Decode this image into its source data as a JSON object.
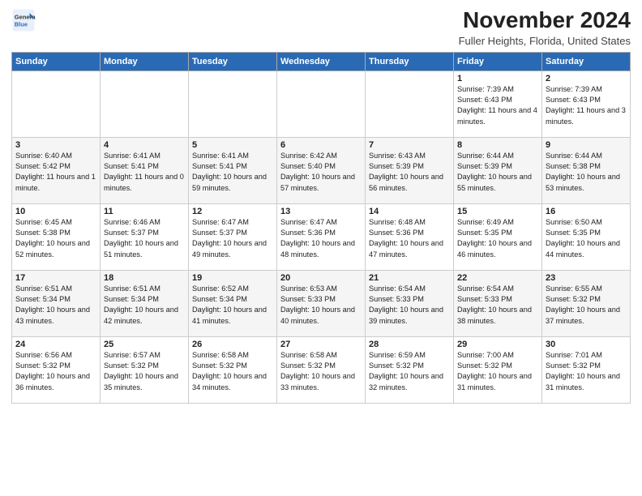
{
  "logo": {
    "general": "General",
    "blue": "Blue"
  },
  "header": {
    "month": "November 2024",
    "location": "Fuller Heights, Florida, United States"
  },
  "days_of_week": [
    "Sunday",
    "Monday",
    "Tuesday",
    "Wednesday",
    "Thursday",
    "Friday",
    "Saturday"
  ],
  "weeks": [
    [
      {
        "day": "",
        "info": ""
      },
      {
        "day": "",
        "info": ""
      },
      {
        "day": "",
        "info": ""
      },
      {
        "day": "",
        "info": ""
      },
      {
        "day": "",
        "info": ""
      },
      {
        "day": "1",
        "info": "Sunrise: 7:39 AM\nSunset: 6:43 PM\nDaylight: 11 hours and 4 minutes."
      },
      {
        "day": "2",
        "info": "Sunrise: 7:39 AM\nSunset: 6:43 PM\nDaylight: 11 hours and 3 minutes."
      }
    ],
    [
      {
        "day": "3",
        "info": "Sunrise: 6:40 AM\nSunset: 5:42 PM\nDaylight: 11 hours and 1 minute."
      },
      {
        "day": "4",
        "info": "Sunrise: 6:41 AM\nSunset: 5:41 PM\nDaylight: 11 hours and 0 minutes."
      },
      {
        "day": "5",
        "info": "Sunrise: 6:41 AM\nSunset: 5:41 PM\nDaylight: 10 hours and 59 minutes."
      },
      {
        "day": "6",
        "info": "Sunrise: 6:42 AM\nSunset: 5:40 PM\nDaylight: 10 hours and 57 minutes."
      },
      {
        "day": "7",
        "info": "Sunrise: 6:43 AM\nSunset: 5:39 PM\nDaylight: 10 hours and 56 minutes."
      },
      {
        "day": "8",
        "info": "Sunrise: 6:44 AM\nSunset: 5:39 PM\nDaylight: 10 hours and 55 minutes."
      },
      {
        "day": "9",
        "info": "Sunrise: 6:44 AM\nSunset: 5:38 PM\nDaylight: 10 hours and 53 minutes."
      }
    ],
    [
      {
        "day": "10",
        "info": "Sunrise: 6:45 AM\nSunset: 5:38 PM\nDaylight: 10 hours and 52 minutes."
      },
      {
        "day": "11",
        "info": "Sunrise: 6:46 AM\nSunset: 5:37 PM\nDaylight: 10 hours and 51 minutes."
      },
      {
        "day": "12",
        "info": "Sunrise: 6:47 AM\nSunset: 5:37 PM\nDaylight: 10 hours and 49 minutes."
      },
      {
        "day": "13",
        "info": "Sunrise: 6:47 AM\nSunset: 5:36 PM\nDaylight: 10 hours and 48 minutes."
      },
      {
        "day": "14",
        "info": "Sunrise: 6:48 AM\nSunset: 5:36 PM\nDaylight: 10 hours and 47 minutes."
      },
      {
        "day": "15",
        "info": "Sunrise: 6:49 AM\nSunset: 5:35 PM\nDaylight: 10 hours and 46 minutes."
      },
      {
        "day": "16",
        "info": "Sunrise: 6:50 AM\nSunset: 5:35 PM\nDaylight: 10 hours and 44 minutes."
      }
    ],
    [
      {
        "day": "17",
        "info": "Sunrise: 6:51 AM\nSunset: 5:34 PM\nDaylight: 10 hours and 43 minutes."
      },
      {
        "day": "18",
        "info": "Sunrise: 6:51 AM\nSunset: 5:34 PM\nDaylight: 10 hours and 42 minutes."
      },
      {
        "day": "19",
        "info": "Sunrise: 6:52 AM\nSunset: 5:34 PM\nDaylight: 10 hours and 41 minutes."
      },
      {
        "day": "20",
        "info": "Sunrise: 6:53 AM\nSunset: 5:33 PM\nDaylight: 10 hours and 40 minutes."
      },
      {
        "day": "21",
        "info": "Sunrise: 6:54 AM\nSunset: 5:33 PM\nDaylight: 10 hours and 39 minutes."
      },
      {
        "day": "22",
        "info": "Sunrise: 6:54 AM\nSunset: 5:33 PM\nDaylight: 10 hours and 38 minutes."
      },
      {
        "day": "23",
        "info": "Sunrise: 6:55 AM\nSunset: 5:32 PM\nDaylight: 10 hours and 37 minutes."
      }
    ],
    [
      {
        "day": "24",
        "info": "Sunrise: 6:56 AM\nSunset: 5:32 PM\nDaylight: 10 hours and 36 minutes."
      },
      {
        "day": "25",
        "info": "Sunrise: 6:57 AM\nSunset: 5:32 PM\nDaylight: 10 hours and 35 minutes."
      },
      {
        "day": "26",
        "info": "Sunrise: 6:58 AM\nSunset: 5:32 PM\nDaylight: 10 hours and 34 minutes."
      },
      {
        "day": "27",
        "info": "Sunrise: 6:58 AM\nSunset: 5:32 PM\nDaylight: 10 hours and 33 minutes."
      },
      {
        "day": "28",
        "info": "Sunrise: 6:59 AM\nSunset: 5:32 PM\nDaylight: 10 hours and 32 minutes."
      },
      {
        "day": "29",
        "info": "Sunrise: 7:00 AM\nSunset: 5:32 PM\nDaylight: 10 hours and 31 minutes."
      },
      {
        "day": "30",
        "info": "Sunrise: 7:01 AM\nSunset: 5:32 PM\nDaylight: 10 hours and 31 minutes."
      }
    ]
  ]
}
